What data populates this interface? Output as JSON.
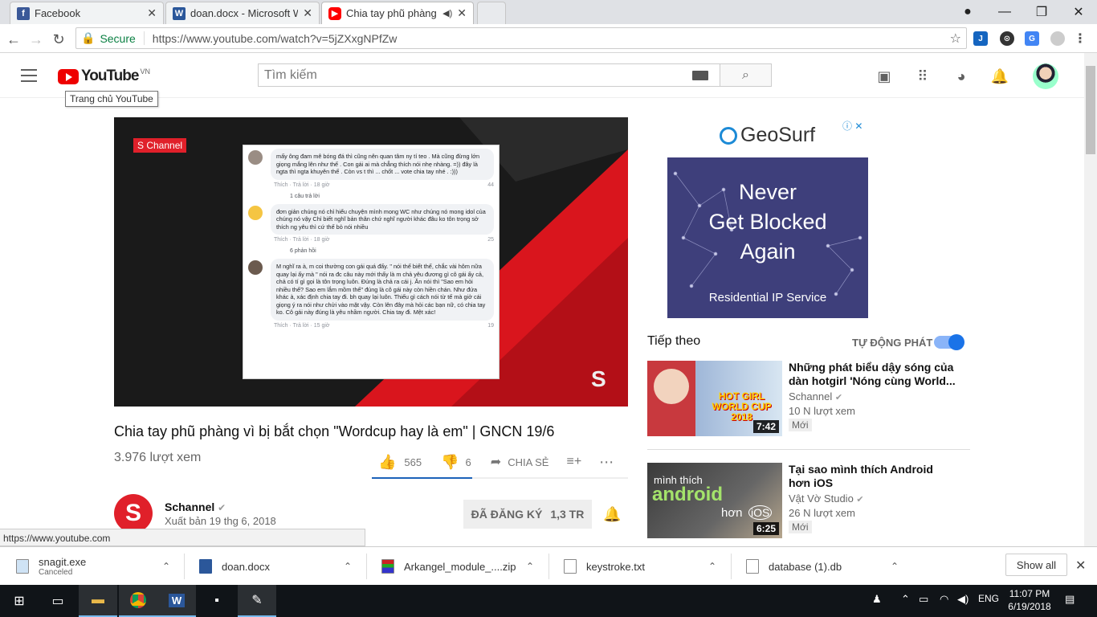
{
  "browser": {
    "tabs": [
      {
        "title": "Facebook",
        "icon": "facebook-icon",
        "color": "#3b5998"
      },
      {
        "title": "doan.docx - Microsoft Wo",
        "icon": "word-icon",
        "color": "#2b579a"
      },
      {
        "title": "Chia tay phũ phàng vì",
        "icon": "youtube-icon",
        "color": "#ff0000"
      }
    ],
    "secure_label": "Secure",
    "url": "https://www.youtube.com/watch?v=5jZXxgNPfZw"
  },
  "yt": {
    "logo": "YouTube",
    "country": "VN",
    "logo_tooltip": "Trang chủ YouTube",
    "search_placeholder": "Tìm kiếm"
  },
  "player": {
    "channel_logo": "Channel",
    "comments": [
      {
        "text": "mấy ông đam mê bóng đá thì cũng nên quan tâm ny tí teo . Mà cũng đừng lớn giọng mắng lên như thế . Con gái ai mà chẳng thích nói nhẹ nhàng. =)) đây là ngta thì ngta khuyên thế . Còn vs t thì ... chốt ... vote chia tay nhé . :)))",
        "meta": "Thích · Trả lời · 18 giờ",
        "count": "44",
        "reply": "1 câu trả lời"
      },
      {
        "text": "đơn giản chúng nó chỉ hiểu chuyện mình mong WC như chúng nó mong idol của chúng nó vậy Chỉ biết nghĩ bản thân chứ nghĩ người khác đâu ko tôn trọng sở thích ng yêu thì cứ thế bỏ nói nhiều",
        "meta": "Thích · Trả lời · 18 giờ",
        "count": "25",
        "reply": "6 phản hồi"
      },
      {
        "text": "M nghĩ ra à, m coi thường con gái quá đấy. \" nói thế biết thế, chắc vài hôm nữa quay lại ấy mà \" nói ra đc câu này mới thấy là m chả yêu đương gì cô gái ấy cả, chả có tí gì gọi là tôn trọng luôn. Đúng là chả ra cái j. Ăn nói thì \"Sao em hỏi nhiều thế? Sao em lắm mồm thế\" đúng là cô gái này còn hiền chán. Như đứa khác à, xác định chia tay đi. bh quay lại luôn. Thiếu gì cách nói từ tế mà giở cái giọng ý ra nói như chửi vào mặt vậy. Còn lên đây mà hỏi các bạn nữ, có chia tay ko. Cô gái này đúng là yêu nhầm người. Chia tay đi. Mệt xác!",
        "meta": "Thích · Trả lời · 15 giờ",
        "count": "19",
        "reply": ""
      }
    ]
  },
  "video": {
    "title": "Chia tay phũ phàng vì bị bắt chọn \"Wordcup hay là em\" | GNCN 19/6",
    "views": "3.976 lượt xem",
    "likes": "565",
    "dislikes": "6",
    "share": "CHIA SẺ",
    "channel": "Schannel",
    "published": "Xuất bản 19 thg 6, 2018",
    "subscribe_label": "ĐÃ ĐĂNG KÝ",
    "subscribers": "1,3 TR"
  },
  "status_url": "https://www.youtube.com",
  "ad": {
    "brand": "GeoSurf",
    "line1": "Never",
    "line2": "Get Blocked",
    "line3": "Again",
    "footer": "Residential IP Service"
  },
  "sidebar": {
    "up_next": "Tiếp theo",
    "autoplay": "TỰ ĐỘNG PHÁT",
    "autoplay_on": true,
    "videos": [
      {
        "title": "Những phát biểu dậy sóng của dàn hotgirl 'Nóng cùng World...",
        "channel": "Schannel",
        "views": "10 N lượt xem",
        "badge": "Mới",
        "duration": "7:42",
        "thumb_text": "HOT GIRL WORLD CUP 2018"
      },
      {
        "title": "Tại sao mình thích Android hơn iOS",
        "channel": "Vật Vờ Studio",
        "views": "26 N lượt xem",
        "badge": "Mới",
        "duration": "6:25",
        "thumb_text_1": "mình thích",
        "thumb_text_2": "android",
        "thumb_text_3": "hơn",
        "thumb_text_4": "iOS"
      }
    ]
  },
  "downloads": [
    {
      "name": "snagit.exe",
      "status": "Canceled"
    },
    {
      "name": "doan.docx",
      "status": ""
    },
    {
      "name": "Arkangel_module_....zip",
      "status": ""
    },
    {
      "name": "keystroke.txt",
      "status": ""
    },
    {
      "name": "database (1).db",
      "status": ""
    }
  ],
  "downloads_show_all": "Show all",
  "taskbar": {
    "language": "ENG",
    "time": "11:07 PM",
    "date": "6/19/2018"
  }
}
